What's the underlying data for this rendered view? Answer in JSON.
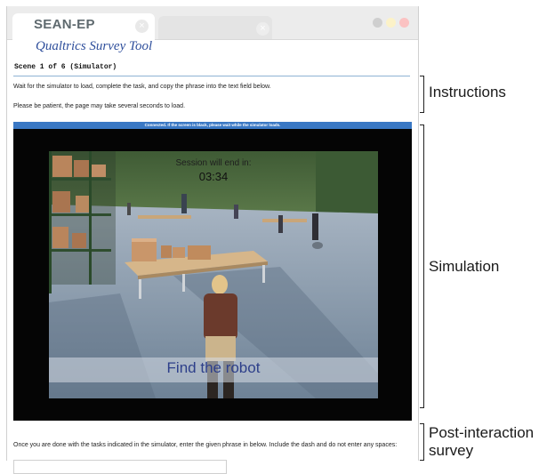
{
  "browser": {
    "active_tab_title": "SEAN-EP",
    "close_glyph": "×",
    "colors": {
      "subtitle": "#2f4f9c",
      "status_bar": "#3a78c4"
    }
  },
  "page": {
    "subtitle": "Qualtrics Survey Tool",
    "scene_title": "Scene 1 of 6 (Simulator)",
    "instructions": [
      "Wait for the simulator to load, complete the task, and copy the phrase into the text field below.",
      "Please be patient, the page may take several seconds to load."
    ],
    "simulator": {
      "status": "Connected. If the screen is black, please wait while the simulator loads.",
      "session_label": "Session will end in:",
      "timer": "03:34",
      "task_banner": "Find the robot"
    },
    "post_instruction": "Once you are done with the tasks indicated in the simulator, enter the given phrase in below. Include the dash and do not enter any spaces:",
    "phrase_input": {
      "value": "",
      "placeholder": ""
    }
  },
  "annotations": {
    "instructions": "Instructions",
    "simulation": "Simulation",
    "post_interaction": [
      "Post-interaction",
      "survey"
    ]
  }
}
